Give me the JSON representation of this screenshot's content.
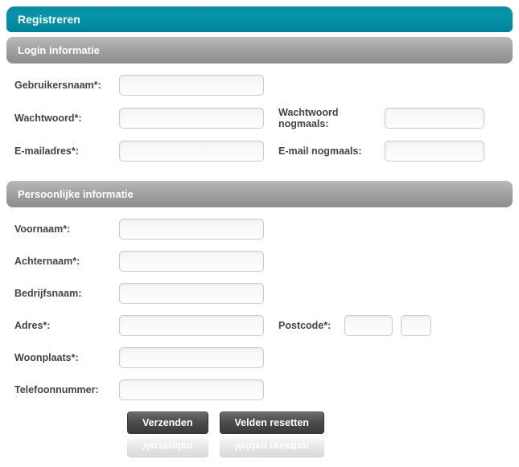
{
  "header": {
    "title": "Registreren"
  },
  "sections": {
    "login": {
      "title": "Login informatie",
      "fields": {
        "username_label": "Gebruikersnaam*:",
        "password_label": "Wachtwoord*:",
        "password_again_label": "Wachtwoord nogmaals:",
        "email_label": "E-mailadres*:",
        "email_again_label": "E-mail nogmaals:",
        "username_value": "",
        "password_value": "",
        "password_again_value": "",
        "email_value": "",
        "email_again_value": ""
      }
    },
    "personal": {
      "title": "Persoonlijke informatie",
      "fields": {
        "firstname_label": "Voornaam*:",
        "lastname_label": "Achternaam*:",
        "company_label": "Bedrijfsnaam:",
        "address_label": "Adres*:",
        "postcode_label": "Postcode*:",
        "city_label": "Woonplaats*:",
        "phone_label": "Telefoonnummer:",
        "firstname_value": "",
        "lastname_value": "",
        "company_value": "",
        "address_value": "",
        "postcode1_value": "",
        "postcode2_value": "",
        "city_value": "",
        "phone_value": ""
      }
    }
  },
  "actions": {
    "submit_label": "Verzenden",
    "reset_label": "Velden resetten"
  }
}
